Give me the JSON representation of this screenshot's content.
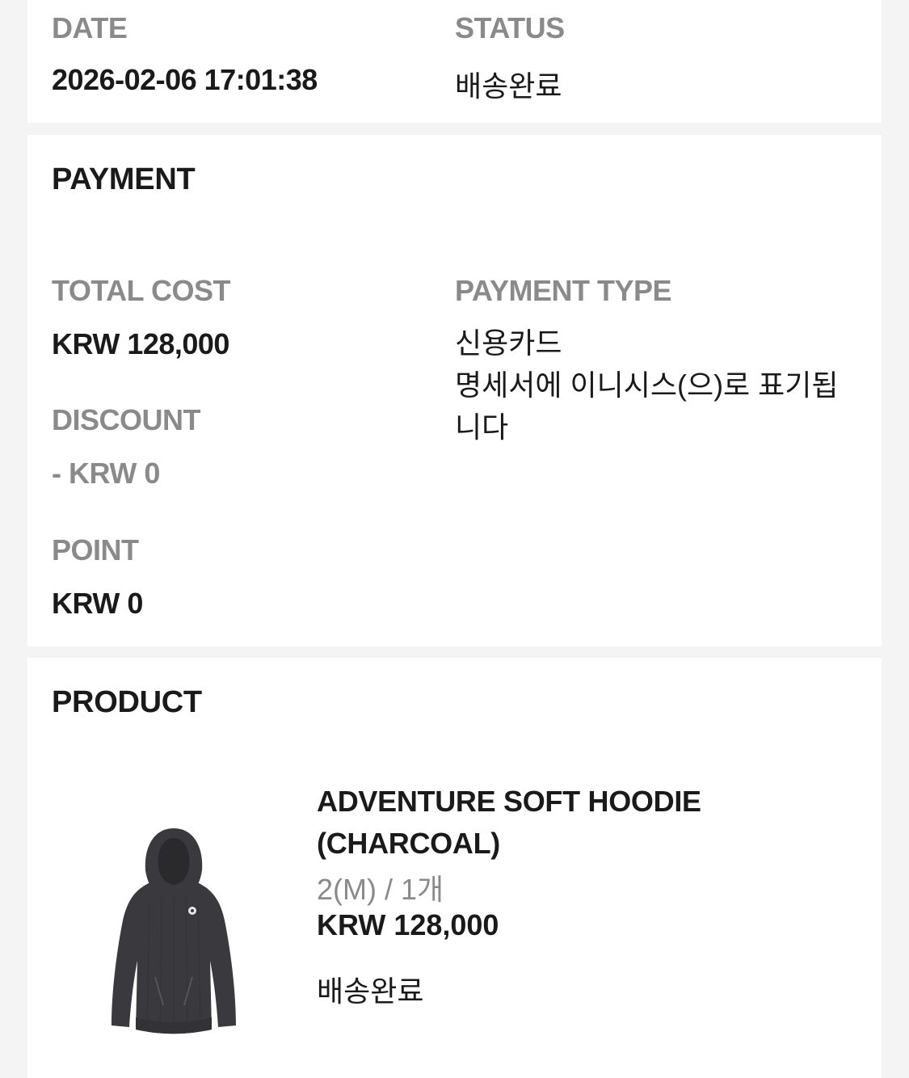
{
  "order": {
    "date_label": "DATE",
    "date_value": "2026-02-06 17:01:38",
    "status_label": "STATUS",
    "status_value": "배송완료"
  },
  "payment": {
    "title": "PAYMENT",
    "total_cost_label": "TOTAL COST",
    "total_cost_value": "KRW 128,000",
    "discount_label": "DISCOUNT",
    "discount_value": "- KRW 0",
    "point_label": "POINT",
    "point_value": "KRW 0",
    "payment_type_label": "PAYMENT TYPE",
    "payment_type_value": "신용카드\n명세서에 이니시스(으)로 표기됩니다"
  },
  "product": {
    "title": "PRODUCT",
    "items": [
      {
        "name": "ADVENTURE SOFT HOODIE (CHARCOAL)",
        "option": "2(M) / 1개",
        "price": "KRW 128,000",
        "status": "배송완료",
        "image_icon": "charcoal-hoodie-image"
      }
    ]
  },
  "colors": {
    "background": "#f4f4f4",
    "card": "#ffffff",
    "text": "#1a1a1a",
    "muted": "#8a8a8a",
    "hoodie": "#3a3a3e"
  }
}
